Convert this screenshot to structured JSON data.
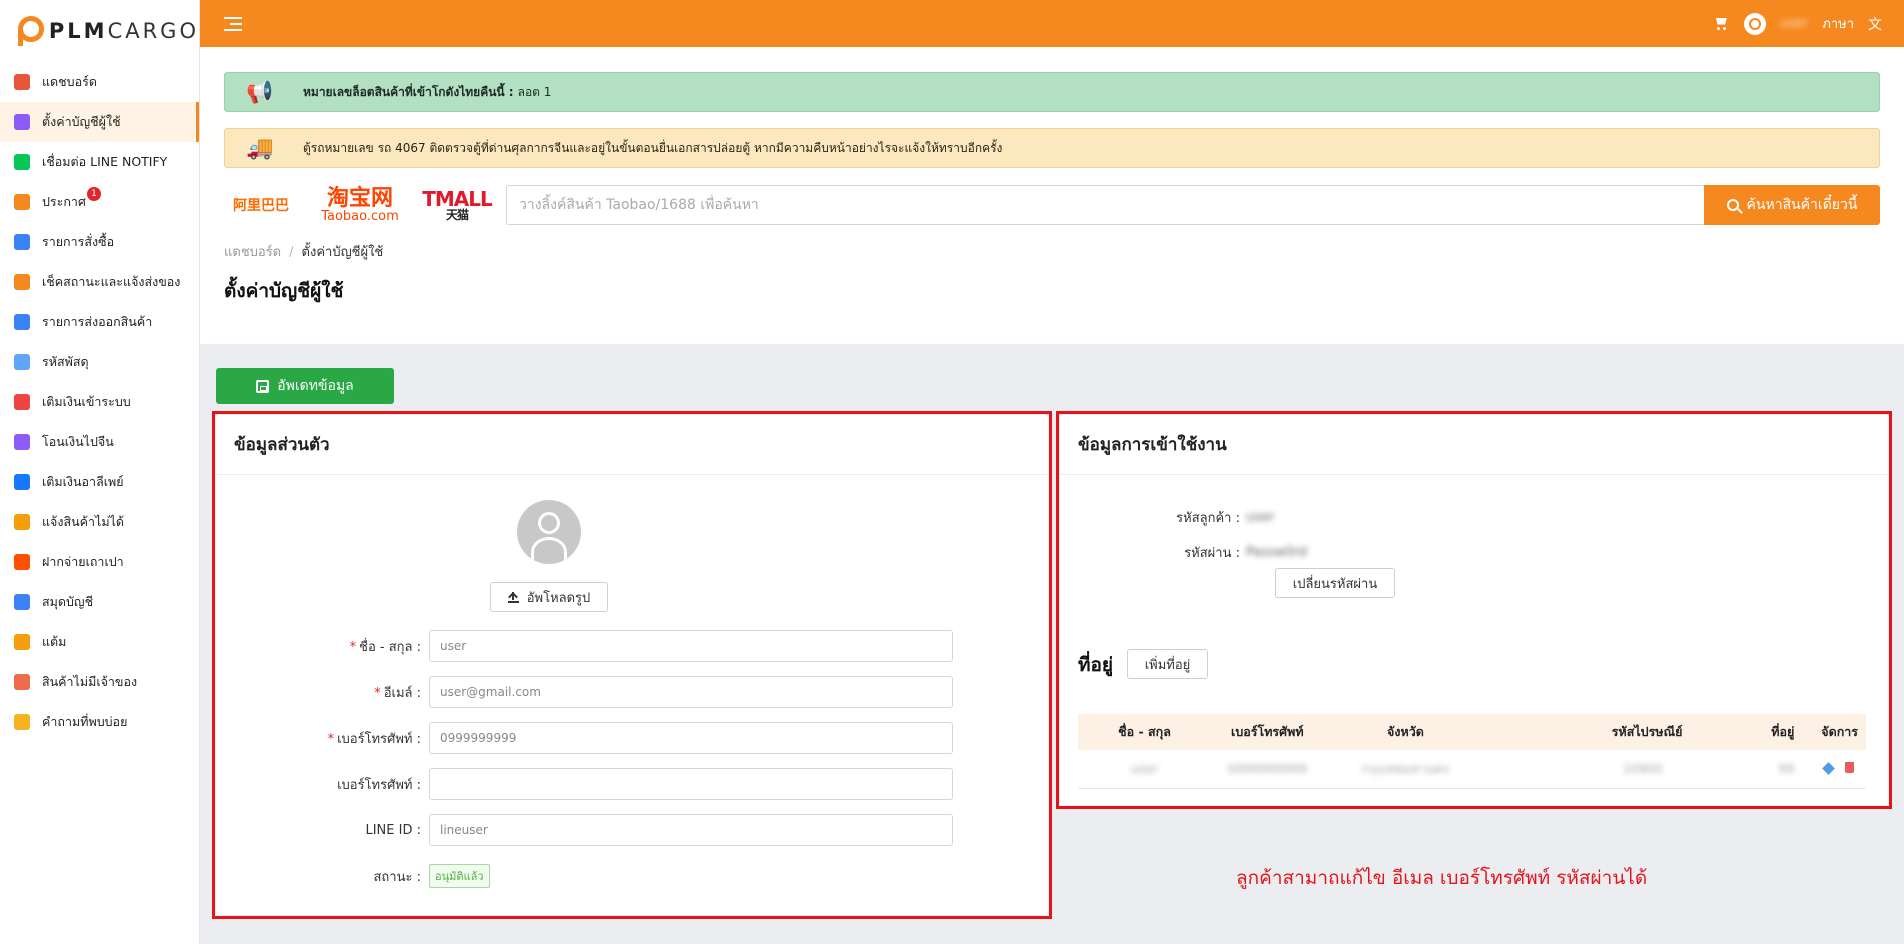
{
  "brand": {
    "name_bold": "PLM",
    "name_rest": "CARGO",
    "accent": "#f5881f"
  },
  "sidebar": {
    "items": [
      {
        "label": "แดชบอร์ด",
        "icon": "chart-icon",
        "color": "#e8563a"
      },
      {
        "label": "ตั้งค่าบัญชีผู้ใช้",
        "icon": "user-settings-icon",
        "color": "#8b5cf6",
        "active": true
      },
      {
        "label": "เชื่อมต่อ LINE NOTIFY",
        "icon": "line-icon",
        "color": "#06c755"
      },
      {
        "label": "ประกาศ",
        "icon": "megaphone-icon",
        "color": "#f5881f",
        "badge": "1"
      },
      {
        "label": "รายการสั่งซื้อ",
        "icon": "cart-box-icon",
        "color": "#3b82f6"
      },
      {
        "label": "เช็คสถานะและแจ้งส่งของ",
        "icon": "truck-icon",
        "color": "#f5881f"
      },
      {
        "label": "รายการส่งออกสินค้า",
        "icon": "trolley-icon",
        "color": "#3b82f6"
      },
      {
        "label": "รหัสพัสดุ",
        "icon": "box-icon",
        "color": "#60a5fa"
      },
      {
        "label": "เติมเงินเข้าระบบ",
        "icon": "piggy-icon",
        "color": "#ef4444"
      },
      {
        "label": "โอนเงินไปจีน",
        "icon": "yuan-icon",
        "color": "#8b5cf6"
      },
      {
        "label": "เติมเงินอาลีเพย์",
        "icon": "alipay-icon",
        "color": "#1677ff"
      },
      {
        "label": "แจ้งสินค้าไม่ได้",
        "icon": "block-icon",
        "color": "#f59e0b"
      },
      {
        "label": "ฝากจ่ายเถาเปา",
        "icon": "taobao-icon",
        "color": "#ff5000"
      },
      {
        "label": "สมุดบัญชี",
        "icon": "wallet-icon",
        "color": "#3b82f6"
      },
      {
        "label": "แต้ม",
        "icon": "coin-bag-icon",
        "color": "#f59e0b"
      },
      {
        "label": "สินค้าไม่มีเจ้าของ",
        "icon": "search-box-icon",
        "color": "#ef6c4a"
      },
      {
        "label": "คำถามที่พบบ่อย",
        "icon": "question-icon",
        "color": "#f5b41f"
      }
    ]
  },
  "header": {
    "username": "user",
    "language": "ภาษา"
  },
  "alerts": {
    "lot_label": "หมายเลขล็อตสินค้าที่เข้าโกดังไทยคืนนี้ :",
    "lot_value": "ลอต 1",
    "truck_message": "ตู้รถหมายเลข รถ 4067 ติดตรวจตู้ที่ด่านศุลกากรจีนและอยู่ในขั้นตอนยื่นเอกสารปล่อยตู้ หากมีความคืบหน้าอย่างไรจะแจ้งให้ทราบอีกครั้ง"
  },
  "search": {
    "brand_1688": "阿里巴巴",
    "brand_taobao_cn": "淘宝网",
    "brand_taobao_en": "Taobao.com",
    "brand_tmall": "TMALL",
    "brand_tmall_sub": "天猫",
    "placeholder": "วางลิ้งค์สินค้า Taobao/1688 เพื่อค้นหา",
    "button": "ค้นหาสินค้าเดี๋ยวนี้"
  },
  "breadcrumb": {
    "home": "แดชบอร์ด",
    "current": "ตั้งค่าบัญชีผู้ใช้"
  },
  "page_title": "ตั้งค่าบัญชีผู้ใช้",
  "update_button": "อัพเดทข้อมูล",
  "personal": {
    "title": "ข้อมูลส่วนตัว",
    "upload_button": "อัพโหลดรูป",
    "fields": {
      "name_label": "ชื่อ - สกุล :",
      "name_value": "user",
      "email_label": "อีเมล์ :",
      "email_value": "user@gmail.com",
      "phone_label": "เบอร์โทรศัพท์ :",
      "phone_value": "0999999999",
      "phone2_label": "เบอร์โทรศัพท์ :",
      "phone2_value": "",
      "line_label": "LINE ID :",
      "line_value": "lineuser",
      "status_label": "สถานะ :",
      "status_value": "อนุมัติแล้ว"
    }
  },
  "login": {
    "title": "ข้อมูลการเข้าใช้งาน",
    "customer_code_label": "รหัสลูกค้า :",
    "customer_code_value": "user",
    "password_label": "รหัสผ่าน :",
    "password_value": "Passw0rd",
    "change_password_button": "เปลี่ยนรหัสผ่าน"
  },
  "address": {
    "title": "ที่อยู่",
    "add_button": "เพิ่มที่อยู่",
    "columns": [
      "ชื่อ - สกุล",
      "เบอร์โทรศัพท์",
      "จังหวัด",
      "รหัสไปรษณีย์",
      "ที่อยู่",
      "จัดการ"
    ],
    "row": {
      "name": "user",
      "phone": "0999999999",
      "province": "กรุงเทพมหานคร",
      "postcode": "10900",
      "address": "99"
    }
  },
  "annotation_note": "ลูกค้าสามาถแก้ไข อีเมล เบอร์โทรศัพท์ รหัสผ่านได้"
}
